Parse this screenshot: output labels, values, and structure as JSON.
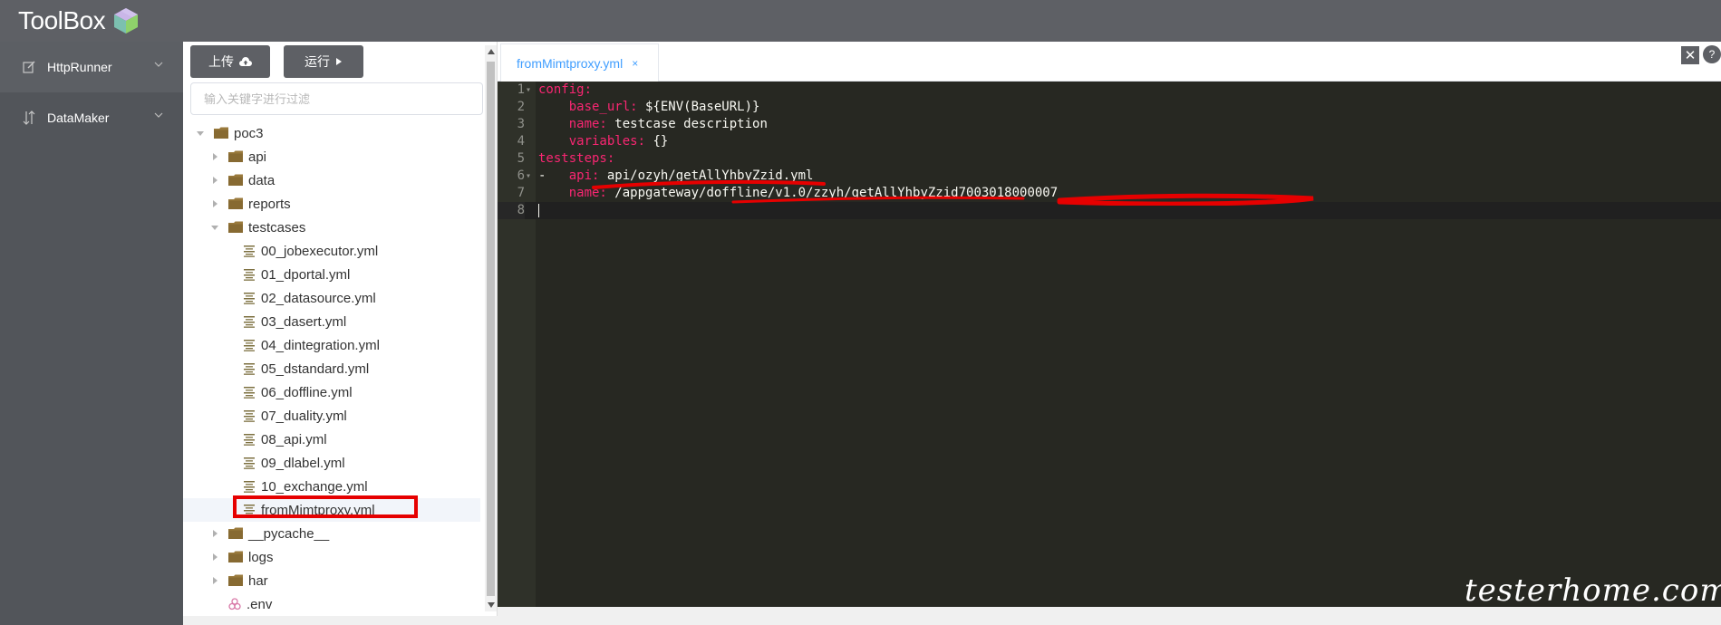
{
  "app": {
    "title": "ToolBox"
  },
  "sidebar": {
    "items": [
      {
        "label": "HttpRunner",
        "icon": "edit-icon"
      },
      {
        "label": "DataMaker",
        "icon": "sort-icon"
      }
    ]
  },
  "toolbar": {
    "upload_label": "上传",
    "run_label": "运行"
  },
  "search": {
    "placeholder": "输入关键字进行过滤"
  },
  "tree": {
    "root": "poc3",
    "items": [
      {
        "label": "api",
        "type": "folder",
        "level": 1
      },
      {
        "label": "data",
        "type": "folder",
        "level": 1
      },
      {
        "label": "reports",
        "type": "folder",
        "level": 1
      },
      {
        "label": "testcases",
        "type": "folder-open",
        "level": 1
      },
      {
        "label": "00_jobexecutor.yml",
        "type": "file",
        "level": 2
      },
      {
        "label": "01_dportal.yml",
        "type": "file",
        "level": 2
      },
      {
        "label": "02_datasource.yml",
        "type": "file",
        "level": 2
      },
      {
        "label": "03_dasert.yml",
        "type": "file",
        "level": 2
      },
      {
        "label": "04_dintegration.yml",
        "type": "file",
        "level": 2
      },
      {
        "label": "05_dstandard.yml",
        "type": "file",
        "level": 2
      },
      {
        "label": "06_doffline.yml",
        "type": "file",
        "level": 2
      },
      {
        "label": "07_duality.yml",
        "type": "file",
        "level": 2
      },
      {
        "label": "08_api.yml",
        "type": "file",
        "level": 2
      },
      {
        "label": "09_dlabel.yml",
        "type": "file",
        "level": 2
      },
      {
        "label": "10_exchange.yml",
        "type": "file",
        "level": 2
      },
      {
        "label": "fromMimtproxy.yml",
        "type": "file",
        "level": 2,
        "selected": true
      },
      {
        "label": "__pycache__",
        "type": "folder",
        "level": 1
      },
      {
        "label": "logs",
        "type": "folder",
        "level": 1
      },
      {
        "label": "har",
        "type": "folder",
        "level": 1
      },
      {
        "label": ".env",
        "type": "env",
        "level": 1
      }
    ]
  },
  "editor": {
    "tab_label": "fromMimtproxy.yml",
    "tab_close": "×",
    "close_label": "✕",
    "help_label": "?",
    "lines": [
      {
        "n": "1",
        "fold": true,
        "key": "config:",
        "rest": ""
      },
      {
        "n": "2",
        "indent": "    ",
        "key": "base_url:",
        "rest": " ${ENV(BaseURL)}"
      },
      {
        "n": "3",
        "indent": "    ",
        "key": "name:",
        "rest": " testcase description"
      },
      {
        "n": "4",
        "indent": "    ",
        "key": "variables:",
        "rest": " {}"
      },
      {
        "n": "5",
        "key": "teststeps:",
        "rest": ""
      },
      {
        "n": "6",
        "fold": true,
        "indent": "-   ",
        "key": "api:",
        "rest": " api/ozyh/getAllYhbyZzid.yml"
      },
      {
        "n": "7",
        "indent": "    ",
        "key": "name:",
        "rest": " /appgateway/doffline/v1.0/zzyh/getAllYhbyZzid7003018000007"
      },
      {
        "n": "8",
        "key": "",
        "rest": ""
      }
    ]
  },
  "watermark": {
    "text": "testerhome.com"
  },
  "colors": {
    "header": "#5e6065",
    "sidebar": "#52555a",
    "accent": "#409eff",
    "editor_bg": "#272822",
    "keyword": "#f92672",
    "highlight": "#e60000"
  }
}
